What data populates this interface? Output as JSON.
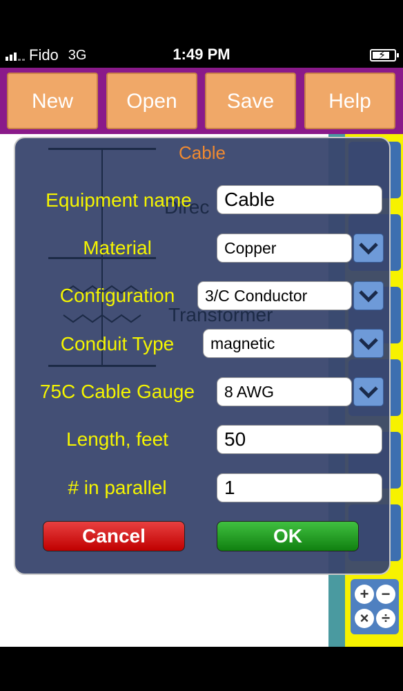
{
  "status_bar": {
    "carrier": "Fido",
    "network": "3G",
    "time": "1:49 PM",
    "battery_icon": "battery-charging-icon"
  },
  "toolbar": {
    "new_label": "New",
    "open_label": "Open",
    "save_label": "Save",
    "help_label": "Help"
  },
  "background": {
    "text_direct": "Direc",
    "text_transformer": "Transformer"
  },
  "dialog": {
    "title": "Cable",
    "fields": {
      "equipment_name": {
        "label": "Equipment name",
        "value": "Cable"
      },
      "material": {
        "label": "Material",
        "value": "Copper"
      },
      "configuration": {
        "label": "Configuration",
        "value": "3/C Conductor"
      },
      "conduit_type": {
        "label": "Conduit Type",
        "value": "magnetic"
      },
      "cable_gauge": {
        "label": "75C Cable Gauge",
        "value": "8 AWG"
      },
      "length": {
        "label": "Length, feet",
        "value": "50"
      },
      "parallel": {
        "label": "# in parallel",
        "value": "1"
      }
    },
    "cancel_label": "Cancel",
    "ok_label": "OK"
  },
  "colors": {
    "toolbar_bg": "#8a1a8a",
    "toolbar_button": "#f0a868",
    "dialog_bg": "#39466e",
    "label_yellow": "#f5f500",
    "title_orange": "#f08a30",
    "cancel_red": "#d02020",
    "ok_green": "#28a028"
  }
}
